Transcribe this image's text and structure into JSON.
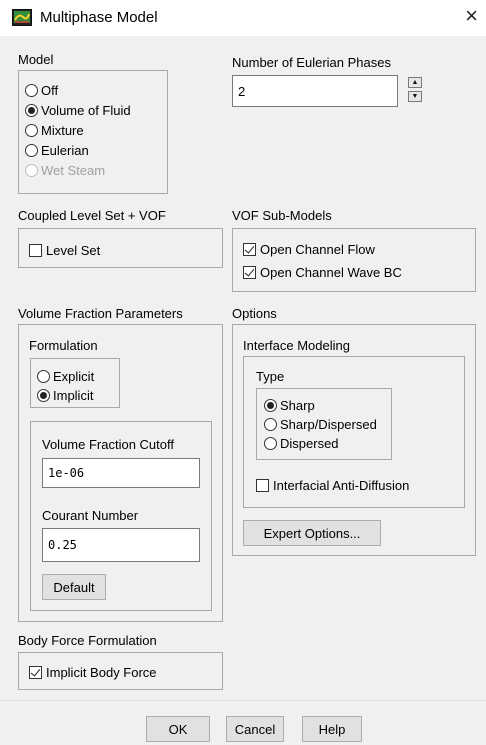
{
  "window": {
    "title": "Multiphase Model",
    "close_glyph": "×",
    "icon": "ansys-fluent-icon"
  },
  "model": {
    "label": "Model",
    "options": [
      {
        "label": "Off",
        "selected": false,
        "enabled": true
      },
      {
        "label": "Volume of Fluid",
        "selected": true,
        "enabled": true
      },
      {
        "label": "Mixture",
        "selected": false,
        "enabled": true
      },
      {
        "label": "Eulerian",
        "selected": false,
        "enabled": true
      },
      {
        "label": "Wet Steam",
        "selected": false,
        "enabled": false
      }
    ]
  },
  "phases": {
    "label": "Number of Eulerian Phases",
    "value": "2",
    "up_glyph": "▲",
    "down_glyph": "▼"
  },
  "coupled": {
    "label": "Coupled Level Set + VOF",
    "level_set_label": "Level Set",
    "level_set_checked": false
  },
  "vof_submodels": {
    "label": "VOF Sub-Models",
    "items": [
      {
        "label": "Open Channel Flow",
        "checked": true
      },
      {
        "label": "Open Channel Wave BC",
        "checked": true
      }
    ]
  },
  "vfp": {
    "label": "Volume Fraction Parameters",
    "formulation_label": "Formulation",
    "formulation_options": [
      {
        "label": "Explicit",
        "selected": false
      },
      {
        "label": "Implicit",
        "selected": true
      }
    ],
    "cutoff_label": "Volume Fraction Cutoff",
    "cutoff_value": "1e-06",
    "courant_label": "Courant Number",
    "courant_value": "0.25",
    "default_button": "Default"
  },
  "options": {
    "label": "Options",
    "interface_label": "Interface Modeling",
    "type_label": "Type",
    "type_options": [
      {
        "label": "Sharp",
        "selected": true
      },
      {
        "label": "Sharp/Dispersed",
        "selected": false
      },
      {
        "label": "Dispersed",
        "selected": false
      }
    ],
    "anti_diffusion_label": "Interfacial Anti-Diffusion",
    "anti_diffusion_checked": false,
    "expert_button": "Expert Options..."
  },
  "body_force": {
    "label": "Body Force Formulation",
    "implicit_label": "Implicit Body Force",
    "implicit_checked": true
  },
  "footer": {
    "ok": "OK",
    "cancel": "Cancel",
    "help": "Help"
  },
  "colors": {
    "dialog_bg": "#f0f0f0",
    "button_bg": "#e1e1e1",
    "frame_border": "#a8a8a8",
    "disabled_text": "#a0a0a0"
  }
}
